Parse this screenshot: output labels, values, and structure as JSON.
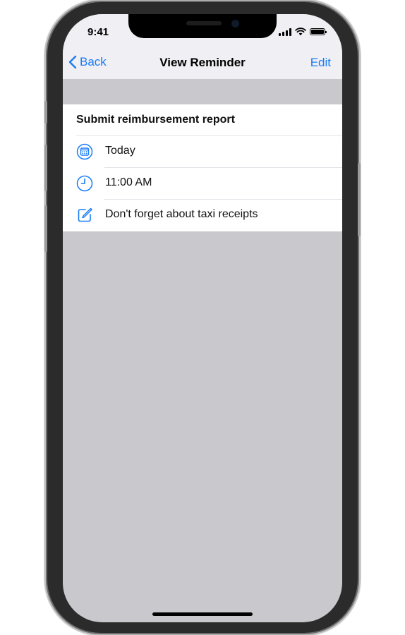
{
  "status_bar": {
    "time": "9:41"
  },
  "nav": {
    "back_label": "Back",
    "title": "View Reminder",
    "edit_label": "Edit"
  },
  "reminder": {
    "title": "Submit reimbursement report",
    "date": "Today",
    "time": "11:00 AM",
    "note": "Don't forget about taxi receipts"
  },
  "icons": {
    "back": "chevron-left-icon",
    "date": "calendar-icon",
    "time": "clock-icon",
    "note": "edit-note-icon"
  },
  "colors": {
    "accent": "#1a7cf5",
    "background": "#c8c8cd",
    "nav_bar": "#efeff4"
  }
}
